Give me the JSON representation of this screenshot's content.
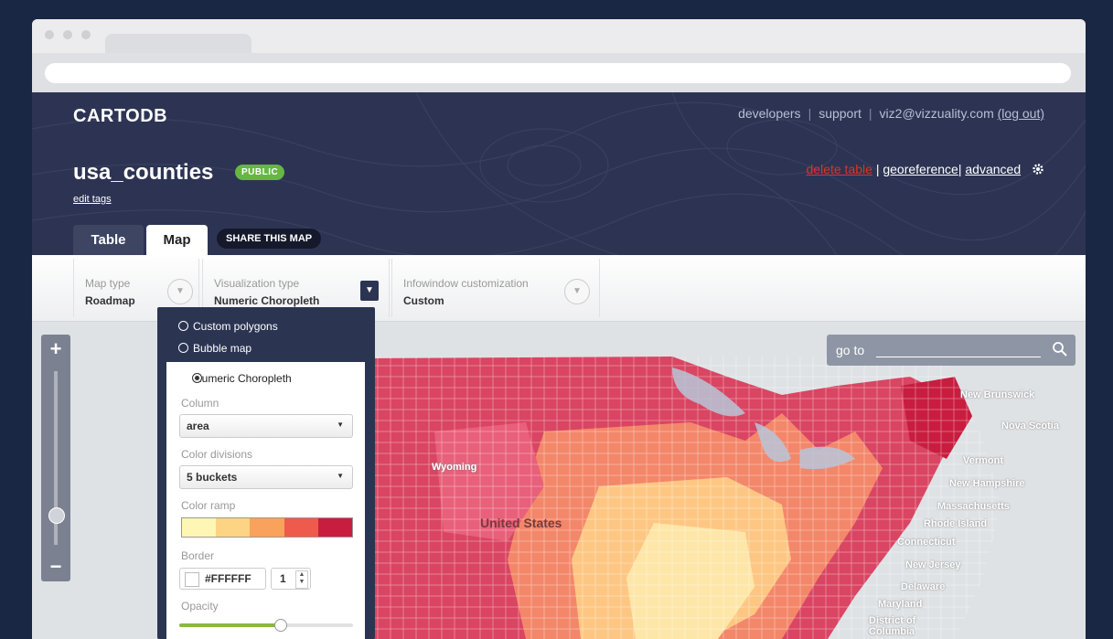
{
  "app": {
    "logo": "CARTODB"
  },
  "top_links": {
    "developers": "developers",
    "support": "support",
    "email": "viz2@vizzuality.com",
    "logout": "(log out)"
  },
  "table": {
    "name": "usa_counties",
    "privacy": "PUBLIC",
    "edit_tags": "edit tags"
  },
  "actions": {
    "delete": "delete table",
    "georeference": "georeference",
    "advanced": "advanced",
    "separator": "|"
  },
  "tabs": {
    "table": "Table",
    "map": "Map",
    "share": "SHARE THIS MAP"
  },
  "toolbar": {
    "map_type": {
      "label": "Map type",
      "value": "Roadmap"
    },
    "viz_type": {
      "label": "Visualization type",
      "value": "Numeric Choropleth"
    },
    "infowindow": {
      "label": "Infowindow customization",
      "value": "Custom"
    }
  },
  "viz_panel": {
    "options": [
      "Custom polygons",
      "Bubble map",
      "Numeric Choropleth"
    ],
    "selected": "Numeric Choropleth",
    "column_label": "Column",
    "column_value": "area",
    "divisions_label": "Color divisions",
    "divisions_value": "5 buckets",
    "ramp_label": "Color ramp",
    "ramp_colors": [
      "#fef6b5",
      "#fdd384",
      "#f9a25c",
      "#ee5a4b",
      "#c81d3f"
    ],
    "border_label": "Border",
    "border_color": "#FFFFFF",
    "border_width": "1",
    "opacity_label": "Opacity",
    "opacity_value": 0.58
  },
  "map": {
    "goto_placeholder": "go to",
    "country_label": "United States",
    "place_labels": [
      "New Brunswick",
      "Nova Scotia",
      "Vermont",
      "New Hampshire",
      "Massachusetts",
      "Rhode Island",
      "Connecticut",
      "New Jersey",
      "Delaware",
      "Maryland",
      "District of Columbia",
      "Wyoming"
    ]
  },
  "colors": {
    "header_bg": "#2d3453",
    "public_badge": "#67b644",
    "delete_link": "#e0302d",
    "page_bg": "#1a2744"
  }
}
